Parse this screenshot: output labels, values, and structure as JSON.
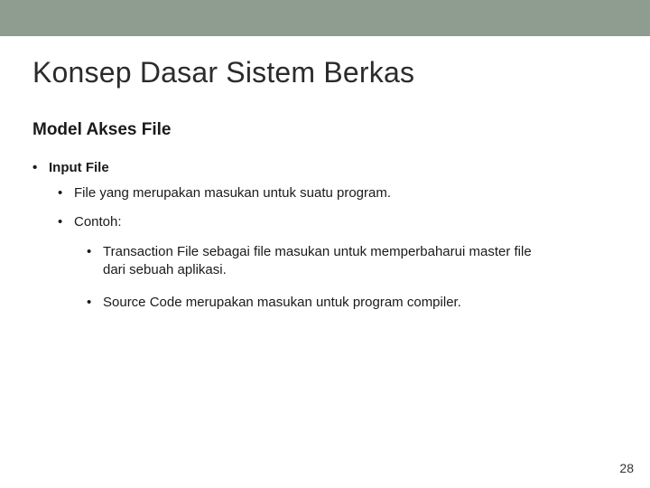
{
  "title": "Konsep Dasar Sistem Berkas",
  "subtitle": "Model Akses File",
  "bullets": {
    "l1": "Input File",
    "l2a": "File yang merupakan masukan untuk suatu program.",
    "l2b": "Contoh:",
    "l3a": "Transaction File sebagai file masukan untuk memperbaharui master file dari sebuah aplikasi.",
    "l3b": "Source Code merupakan masukan untuk program compiler."
  },
  "page_number": "28",
  "colors": {
    "band": "#8e9d90"
  }
}
